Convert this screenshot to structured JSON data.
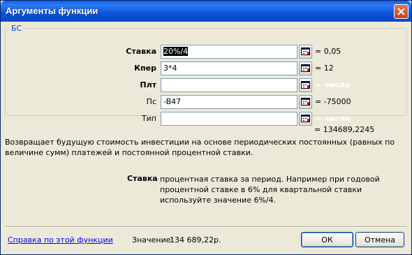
{
  "window": {
    "title": "Аргументы функции"
  },
  "function_name": "БС",
  "args": [
    {
      "label": "Ставка",
      "value": "20%/4",
      "result": "= 0,05",
      "bold": true
    },
    {
      "label": "Кпер",
      "value": "3*4",
      "result": "= 12",
      "bold": true
    },
    {
      "label": "Плт",
      "value": "",
      "result": "= число",
      "bold": true
    },
    {
      "label": "Пс",
      "value": "-B47",
      "result": "= -75000",
      "bold": false
    },
    {
      "label": "Тип",
      "value": "",
      "result": "= число",
      "bold": false
    }
  ],
  "total_result": "= 134689,2245",
  "description": "Возвращает будущую стоимость инвестиции на основе периодических постоянных (равных по величине сумм) платежей и постоянной процентной ставки.",
  "arg_help": {
    "name": "Ставка",
    "text": "процентная ставка за период. Например при годовой процентной ставке в 6% для квартальной ставки используйте значение 6%/4."
  },
  "footer": {
    "help_link": "Справка по этой функции",
    "value_label": "Значение:",
    "value": "134 689,22р.",
    "ok_label": "ОК",
    "cancel_label": "Отмена"
  },
  "icons": {
    "close": "close-icon",
    "ref": "collapse-dialog-icon"
  },
  "colors": {
    "title_bar": "#0a55d9",
    "link": "#0000ff",
    "legend": "#0046d5"
  }
}
